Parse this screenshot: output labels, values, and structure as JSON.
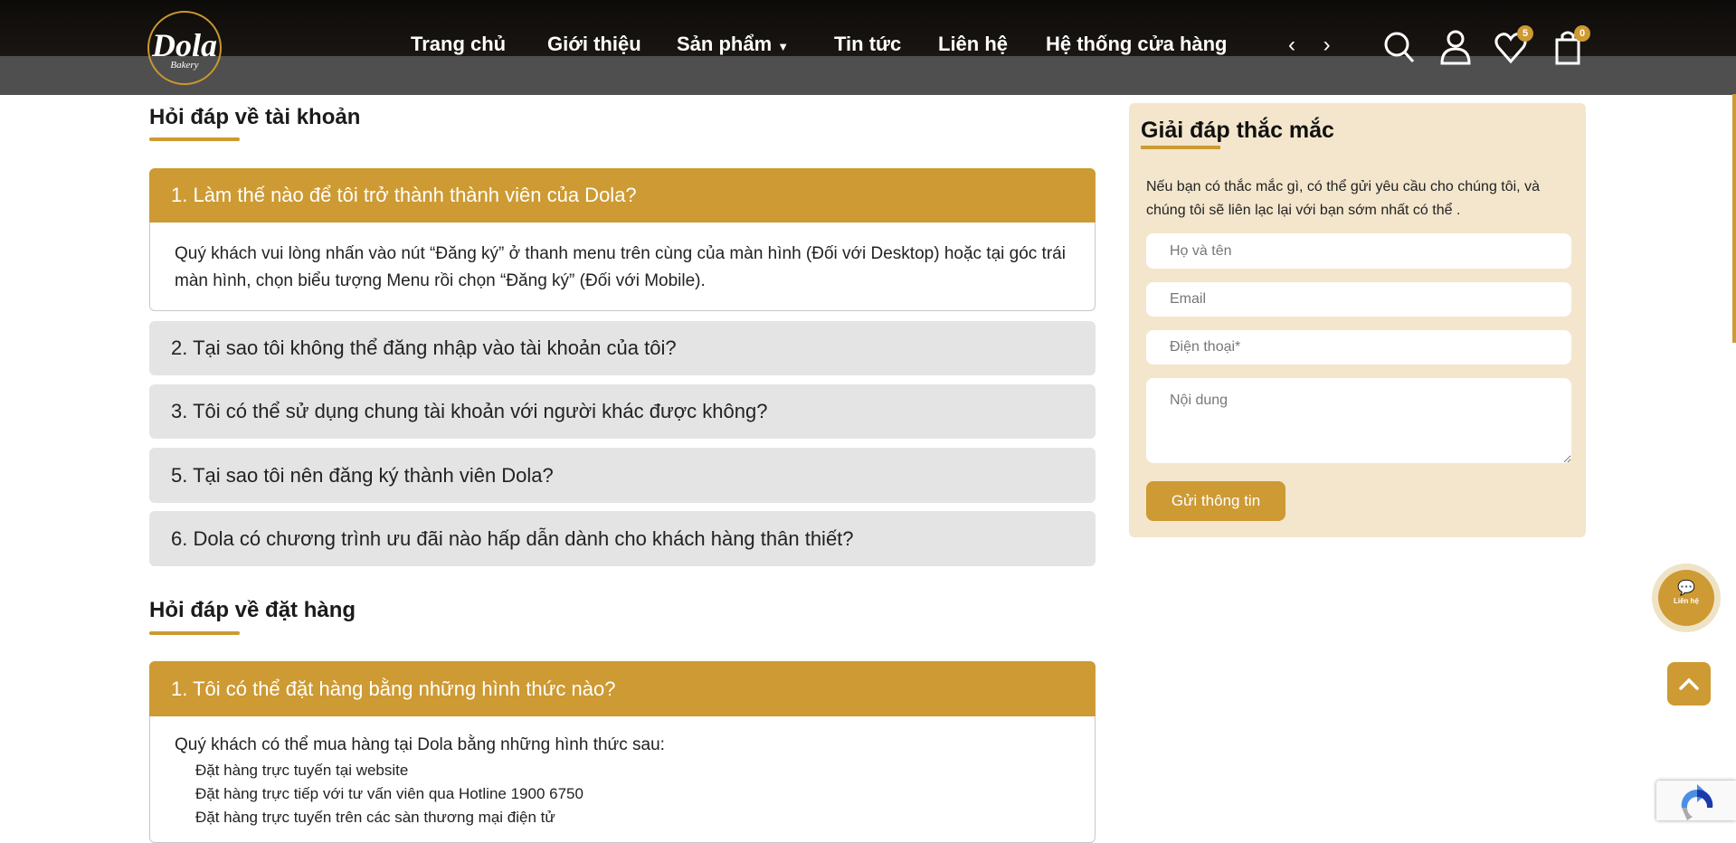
{
  "header": {
    "logo": {
      "name": "Dola",
      "sub": "Bakery"
    },
    "nav": [
      {
        "label": "Trang chủ"
      },
      {
        "label": "Giới thiệu"
      },
      {
        "label": "Sản phẩm",
        "has_dropdown": true
      },
      {
        "label": "Tin tức"
      },
      {
        "label": "Liên hệ"
      },
      {
        "label": "Hệ thống cửa hàng"
      }
    ],
    "arrows": "‹ ›",
    "wishlist_count": "5",
    "cart_count": "0"
  },
  "sections": [
    {
      "title": "Hỏi đáp về tài khoản",
      "items": [
        {
          "q": "1. Làm thế nào để tôi trở thành thành viên của Dola?",
          "open": true,
          "answer": "Quý khách vui lòng nhấn vào nút “Đăng ký” ở thanh menu trên cùng của màn hình (Đối với Desktop) hoặc tại góc trái màn hình, chọn biểu tượng Menu rồi chọn “Đăng ký” (Đối với Mobile)."
        },
        {
          "q": "2. Tại sao tôi không thể đăng nhập vào tài khoản của tôi?"
        },
        {
          "q": "3. Tôi có thể sử dụng chung tài khoản với người khác được không?"
        },
        {
          "q": "5. Tại sao tôi nên đăng ký thành viên Dola?"
        },
        {
          "q": "6. Dola có chương trình ưu đãi nào hấp dẫn dành cho khách hàng thân thiết?"
        }
      ]
    },
    {
      "title": "Hỏi đáp về đặt hàng",
      "items": [
        {
          "q": "1. Tôi có thể đặt hàng bằng những hình thức nào?",
          "open": true,
          "answer": "Quý khách có thể mua hàng tại Dola bằng những hình thức sau:",
          "list": [
            "Đặt hàng trực tuyến tại website",
            "Đặt hàng trực tiếp với tư vấn viên qua Hotline 1900 6750",
            "Đặt hàng trực tuyến trên các sàn thương mại điện tử"
          ]
        }
      ]
    }
  ],
  "contact": {
    "title": "Giải đáp thắc mắc",
    "description": "Nếu bạn có thắc mắc gì, có thể gửi yêu cầu cho chúng tôi, và chúng tôi sẽ liên lạc lại với bạn sớm nhất có thể .",
    "name_placeholder": "Họ và tên",
    "email_placeholder": "Email",
    "phone_placeholder": "Điện thoại*",
    "content_placeholder": "Nội dung",
    "submit_label": "Gửi thông tin"
  },
  "floating": {
    "chat_label": "Liên hệ"
  },
  "colors": {
    "accent": "#cd9a33",
    "panel": "#f3e6cc",
    "closed": "#e4e4e4"
  }
}
